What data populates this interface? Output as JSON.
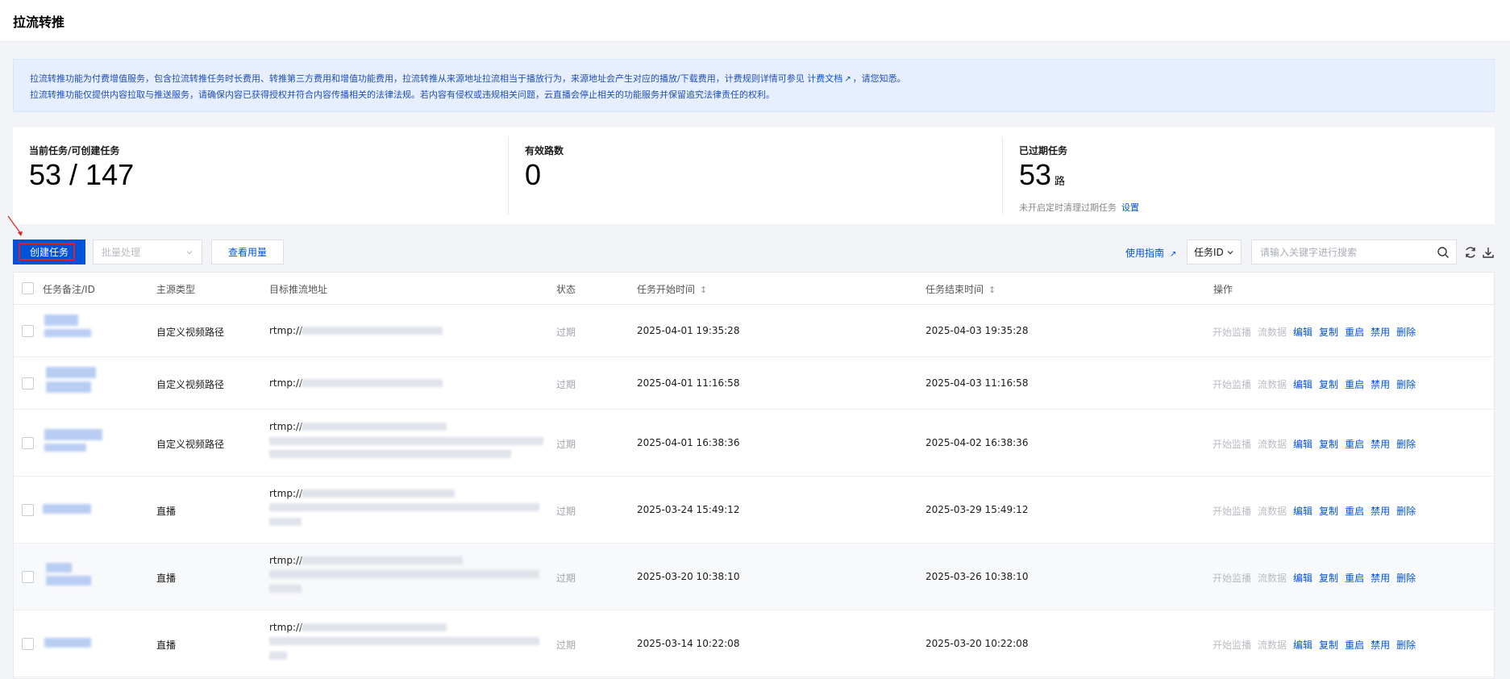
{
  "header": {
    "title": "拉流转推"
  },
  "notice": {
    "line1_pre": "拉流转推功能为付费增值服务，包含拉流转推任务时长费用、转推第三方费用和增值功能费用，拉流转推从来源地址拉流相当于播放行为，来源地址会产生对应的播放/下载费用，计费规则详情可参见",
    "link": "计费文档",
    "line1_post": "，请您知悉。",
    "line2": "拉流转推功能仅提供内容拉取与推送服务，请确保内容已获得授权并符合内容传播相关的法律法规。若内容有侵权或违规相关问题，云直播会停止相关的功能服务并保留追究法律责任的权利。"
  },
  "stats": {
    "current": {
      "label": "当前任务/可创建任务",
      "value": "53 / 147"
    },
    "valid": {
      "label": "有效路数",
      "value": "0"
    },
    "expired": {
      "label": "已过期任务",
      "value": "53",
      "unit": "路",
      "sub": "未开启定时清理过期任务",
      "link": "设置"
    }
  },
  "toolbar": {
    "create": "创建任务",
    "batch": "批量处理",
    "usage": "查看用量",
    "guide": "使用指南",
    "select_value": "任务ID",
    "search_placeholder": "请输入关键字进行搜索"
  },
  "table": {
    "headers": [
      "任务备注/ID",
      "主源类型",
      "目标推流地址",
      "状态",
      "任务开始时间",
      "任务结束时间",
      "操作"
    ],
    "actions": [
      "开始监播",
      "流数据",
      "编辑",
      "复制",
      "重启",
      "禁用",
      "删除"
    ],
    "rows": [
      {
        "url_prefix": "rtmp://",
        "source": "自定义视频路径",
        "status": "过期",
        "start": "2025-04-01 19:35:28",
        "end": "2025-04-03 19:35:28"
      },
      {
        "url_prefix": "rtmp://",
        "source": "自定义视频路径",
        "status": "过期",
        "start": "2025-04-01 11:16:58",
        "end": "2025-04-03 11:16:58"
      },
      {
        "url_prefix": "rtmp://",
        "source": "自定义视频路径",
        "status": "过期",
        "start": "2025-04-01 16:38:36",
        "end": "2025-04-02 16:38:36"
      },
      {
        "url_prefix": "rtmp://",
        "source": "直播",
        "status": "过期",
        "start": "2025-03-24 15:49:12",
        "end": "2025-03-29 15:49:12"
      },
      {
        "url_prefix": "rtmp://",
        "source": "直播",
        "status": "过期",
        "start": "2025-03-20 10:38:10",
        "end": "2025-03-26 10:38:10"
      },
      {
        "url_prefix": "rtmp://",
        "source": "直播",
        "status": "过期",
        "start": "2025-03-14 10:22:08",
        "end": "2025-03-20 10:22:08"
      }
    ]
  },
  "icons": {
    "external_link": "external-link-icon",
    "search": "search-icon",
    "refresh": "refresh-icon",
    "download": "download-icon",
    "chevron": "chevron-down-icon",
    "sort": "sort-icon",
    "annotation_arrow": "annotation-arrow-icon"
  },
  "colors": {
    "primary": "#0052d9",
    "notice_bg": "#e7efff",
    "highlight": "#e02020"
  }
}
